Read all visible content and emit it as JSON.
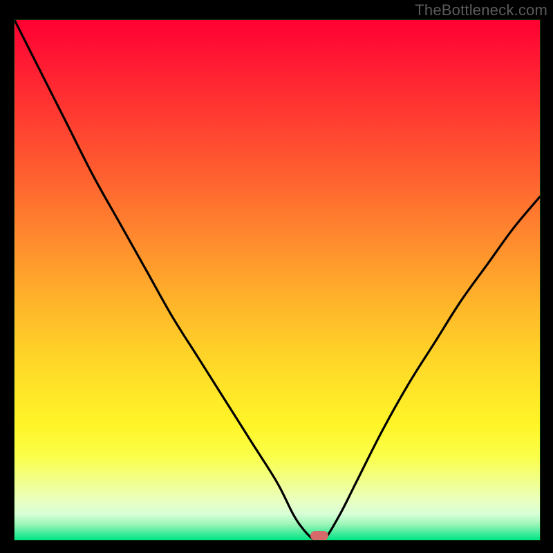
{
  "watermark": "TheBottleneck.com",
  "colors": {
    "background": "#000000",
    "curve": "#000000",
    "marker": "#d66a6a",
    "watermark": "#5c5c5c"
  },
  "chart_data": {
    "type": "line",
    "title": "",
    "xlabel": "",
    "ylabel": "",
    "xlim": [
      0,
      100
    ],
    "ylim": [
      0,
      100
    ],
    "grid": false,
    "series": [
      {
        "name": "bottleneck-curve",
        "x": [
          0,
          5,
          10,
          15,
          20,
          25,
          30,
          35,
          40,
          45,
          50,
          53,
          55,
          57,
          58,
          59,
          62,
          65,
          70,
          75,
          80,
          85,
          90,
          95,
          100
        ],
        "y": [
          100,
          90,
          80,
          70,
          61,
          52,
          43,
          35,
          27,
          19,
          11,
          5,
          2,
          0,
          0,
          0,
          5,
          11,
          21,
          30,
          38,
          46,
          53,
          60,
          66
        ]
      }
    ],
    "marker": {
      "x": 58,
      "y": 0,
      "label": "optimal-point"
    },
    "background_gradient": {
      "direction": "vertical",
      "stops": [
        {
          "pos": 0.0,
          "color": "#ff0033"
        },
        {
          "pos": 0.5,
          "color": "#ffb32a"
        },
        {
          "pos": 0.8,
          "color": "#fff528"
        },
        {
          "pos": 1.0,
          "color": "#00e585"
        }
      ]
    }
  }
}
